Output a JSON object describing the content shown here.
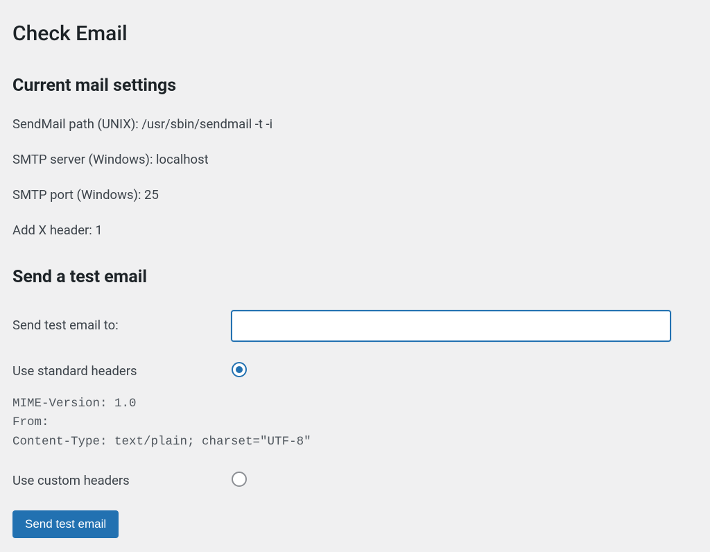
{
  "page": {
    "title": "Check Email"
  },
  "current_mail": {
    "heading": "Current mail settings",
    "sendmail_path_label": "SendMail path (UNIX): ",
    "sendmail_path_value": "/usr/sbin/sendmail -t -i",
    "smtp_server_label": "SMTP server (Windows): ",
    "smtp_server_value": "localhost",
    "smtp_port_label": "SMTP port (Windows): ",
    "smtp_port_value": "25",
    "add_x_header_label": "Add X header: ",
    "add_x_header_value": "1"
  },
  "test_email": {
    "heading": "Send a test email",
    "send_to_label": "Send test email to:",
    "send_to_value": "",
    "use_standard_label": "Use standard headers",
    "standard_headers": "MIME-Version: 1.0\nFrom:\nContent-Type: text/plain; charset=\"UTF-8\"",
    "use_custom_label": "Use custom headers",
    "submit_label": "Send test email"
  }
}
